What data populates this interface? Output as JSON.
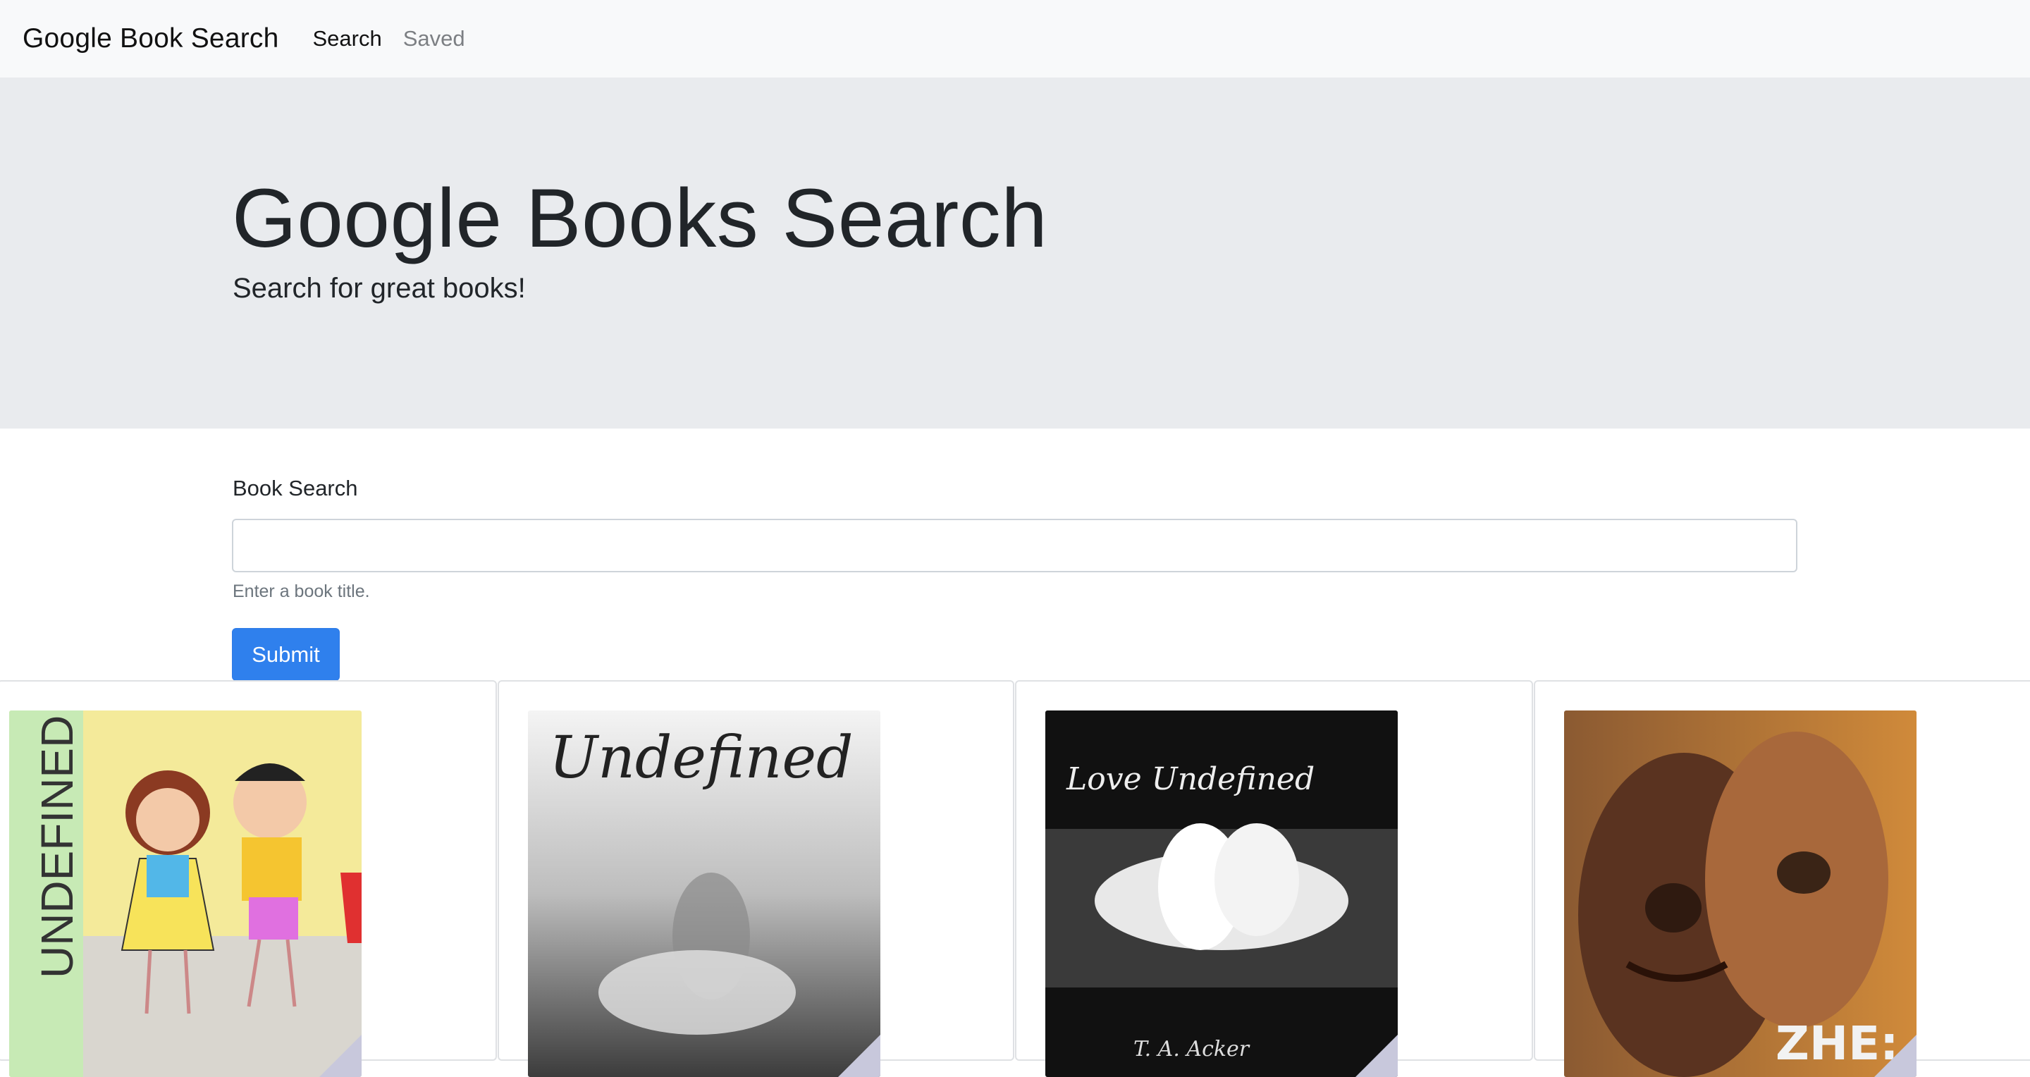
{
  "navbar": {
    "brand": "Google Book Search",
    "links": [
      {
        "label": "Search",
        "active": true
      },
      {
        "label": "Saved",
        "active": false
      }
    ]
  },
  "jumbotron": {
    "title": "Google Books Search",
    "lead": "Search for great books!"
  },
  "form": {
    "label": "Book Search",
    "input_value": "",
    "input_placeholder": "",
    "help_text": "Enter a book title.",
    "submit_label": "Submit"
  },
  "results": [
    {
      "cover_text": "UNDEFINED"
    },
    {
      "cover_text": "Undefined"
    },
    {
      "cover_text": "Love Undefined",
      "author": "T. A. Acker"
    },
    {
      "cover_text": "ZHE:"
    }
  ],
  "colors": {
    "navbar_bg": "#f8f9fa",
    "jumbotron_bg": "#e9ebee",
    "primary": "#2f80ed",
    "muted": "#6c757d"
  }
}
